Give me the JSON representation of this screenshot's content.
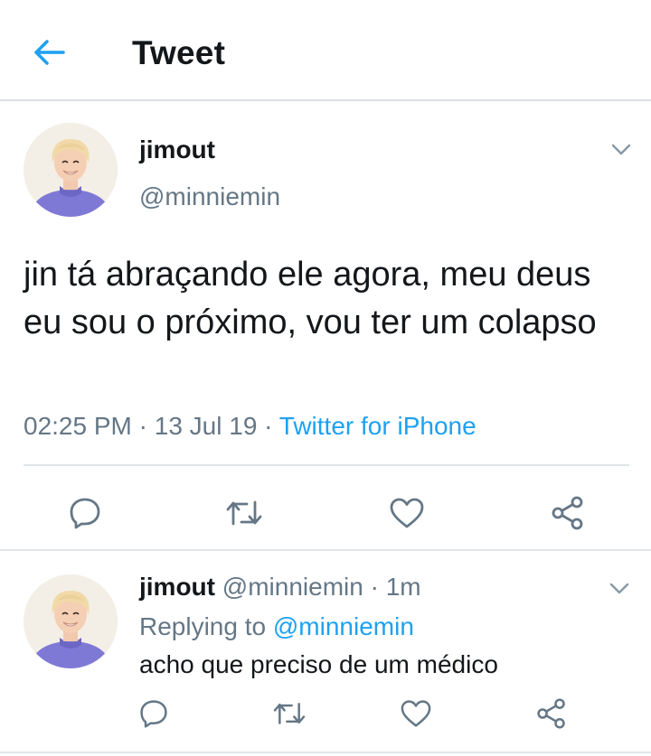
{
  "header": {
    "title": "Tweet",
    "back_icon": "back-arrow-icon",
    "accent": "#1da1f2"
  },
  "main_tweet": {
    "author_name": "jimout",
    "author_handle": "@minniemin",
    "text": "jin tá abraçando ele agora, meu deus eu sou o próximo, vou ter um colapso",
    "time": "02:25 PM",
    "dot1": " · ",
    "date": "13 Jul 19",
    "dot2": " · ",
    "source": "Twitter for iPhone",
    "actions": [
      "reply-icon",
      "retweet-icon",
      "like-icon",
      "share-icon"
    ]
  },
  "reply_tweet": {
    "author_name": "jimout",
    "author_handle": "@minniemin",
    "dot": " · ",
    "age": "1m",
    "replying_prefix": "Replying to ",
    "replying_to": "@minniemin",
    "text": "acho que preciso de um médico",
    "actions": [
      "reply-icon",
      "retweet-icon",
      "like-icon",
      "share-icon"
    ]
  },
  "colors": {
    "text": "#14171a",
    "secondary": "#657786",
    "link": "#1da1f2",
    "divider": "#e1e5e8"
  }
}
